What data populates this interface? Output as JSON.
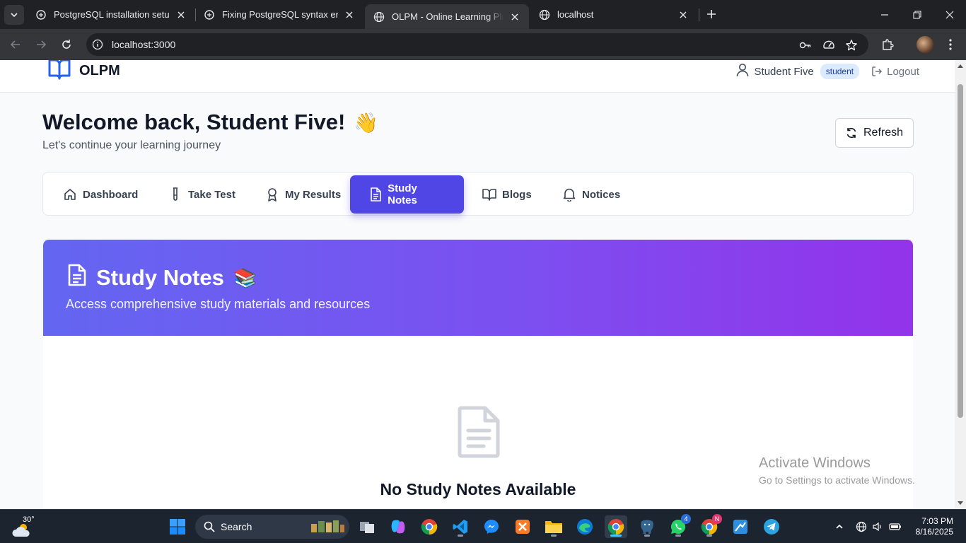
{
  "browser": {
    "tabs": [
      {
        "title": "PostgreSQL installation setup",
        "icon": "openai-icon",
        "active": false
      },
      {
        "title": "Fixing PostgreSQL syntax error",
        "icon": "openai-icon",
        "active": false
      },
      {
        "title": "OLPM - Online Learning Platform",
        "icon": "globe-icon",
        "active": true
      },
      {
        "title": "localhost",
        "icon": "globe-icon",
        "active": false
      }
    ],
    "url": "localhost:3000"
  },
  "header": {
    "brand": "OLPM",
    "user_name": "Student Five",
    "role": "student",
    "logout_label": "Logout"
  },
  "welcome": {
    "title": "Welcome back, Student Five!",
    "emoji": "👋",
    "subtitle": "Let's continue your learning journey",
    "refresh_label": "Refresh"
  },
  "nav": {
    "items": [
      {
        "label": "Dashboard",
        "icon": "home-icon"
      },
      {
        "label": "Take Test",
        "icon": "test-tube-icon"
      },
      {
        "label": "My Results",
        "icon": "award-icon"
      },
      {
        "label": "Study Notes",
        "icon": "file-text-icon",
        "active": true
      },
      {
        "label": "Blogs",
        "icon": "book-open-icon"
      },
      {
        "label": "Notices",
        "icon": "bell-icon"
      }
    ]
  },
  "study_notes": {
    "title": "Study Notes",
    "emoji": "📚",
    "subtitle": "Access comprehensive study materials and resources",
    "empty_title": "No Study Notes Available"
  },
  "watermark": {
    "line1": "Activate Windows",
    "line2": "Go to Settings to activate Windows."
  },
  "taskbar": {
    "temperature": "30°",
    "search_label": "Search",
    "time": "7:03 PM",
    "date": "8/16/2025",
    "whatsapp_badge": "4",
    "chrome_badge": "N"
  },
  "colors": {
    "accent": "#4f46e5",
    "hero_start": "#6366f1",
    "hero_end": "#9333ea",
    "role_badge_bg": "#dbeafe"
  }
}
